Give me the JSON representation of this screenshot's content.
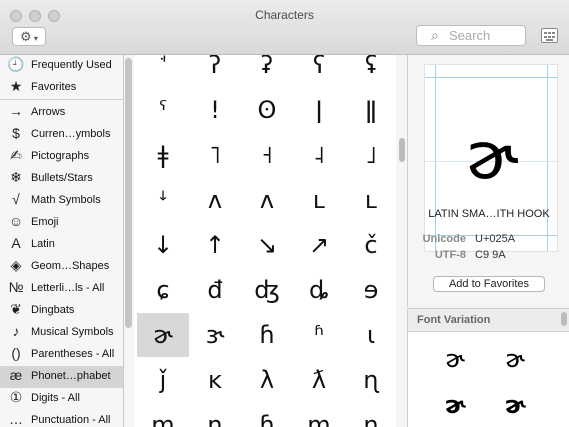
{
  "window": {
    "title": "Characters"
  },
  "toolbar": {
    "action_icon": "gear-icon",
    "search_placeholder": "Search",
    "search_icon": "magnifier-icon",
    "keyboard_icon": "keyboard-viewer-icon"
  },
  "sidebar": {
    "top_items": [
      {
        "label": "Frequently Used",
        "icon": "🕘"
      },
      {
        "label": "Favorites",
        "icon": "★"
      }
    ],
    "categories": [
      {
        "label": "Arrows",
        "icon": "→"
      },
      {
        "label": "Curren…ymbols",
        "icon": "$"
      },
      {
        "label": "Pictographs",
        "icon": "✍"
      },
      {
        "label": "Bullets/Stars",
        "icon": "❄"
      },
      {
        "label": "Math Symbols",
        "icon": "√"
      },
      {
        "label": "Emoji",
        "icon": "☺"
      },
      {
        "label": "Latin",
        "icon": "A"
      },
      {
        "label": "Geom…Shapes",
        "icon": "◈"
      },
      {
        "label": "Letterli…ls - All",
        "icon": "№"
      },
      {
        "label": "Dingbats",
        "icon": "❦"
      },
      {
        "label": "Musical Symbols",
        "icon": "♪"
      },
      {
        "label": "Parentheses - All",
        "icon": "()"
      },
      {
        "label": "Phonet…phabet",
        "icon": "æ"
      },
      {
        "label": "Digits - All",
        "icon": "①"
      },
      {
        "label": "Punctuation - All",
        "icon": "…"
      }
    ],
    "selected_index": 12
  },
  "grid": {
    "rows": [
      [
        "ꜗ",
        "ʔ",
        "ʡ",
        "ʕ",
        "ʢ"
      ],
      [
        "ˁ",
        "ǃ",
        "ʘ",
        "ǀ",
        "ǁ"
      ],
      [
        "ǂ",
        "˥",
        "˧",
        "˨",
        "˩"
      ],
      [
        "ꜜ",
        "ʌ",
        "ʌ",
        "ʟ",
        "ʟ"
      ],
      [
        "↓",
        "↑",
        "↘",
        "↗",
        "č"
      ],
      [
        "ɕ",
        "đ",
        "ʤ",
        "ȡ",
        "ɘ"
      ],
      [
        "ɚ",
        "ɝ",
        "ɦ",
        "ʱ",
        "ɩ"
      ],
      [
        "ǰ",
        "ĸ",
        "λ",
        "ƛ",
        "ɳ"
      ],
      [
        "ɱ",
        "ɲ",
        "ɧ",
        "ɱ",
        "ŋ"
      ]
    ],
    "selected": {
      "row": 6,
      "col": 0
    }
  },
  "info": {
    "char": "ɚ",
    "name": "LATIN SMA…ITH HOOK",
    "unicode_label": "Unicode",
    "unicode_value": "U+025A",
    "utf8_label": "UTF-8",
    "utf8_value": "C9 9A",
    "add_button": "Add to Favorites"
  },
  "font_variation": {
    "header": "Font Variation",
    "glyphs": [
      "ɚ",
      "ɚ",
      "ɚ",
      "ɚ"
    ]
  }
}
